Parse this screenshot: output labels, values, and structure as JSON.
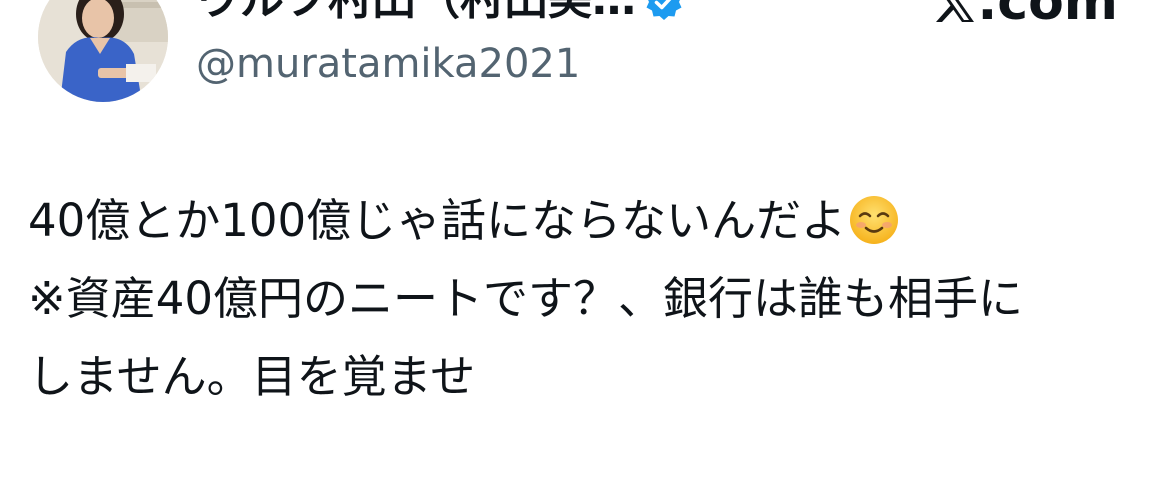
{
  "tweet": {
    "author": {
      "display_name": "ウルフ村田（村田美…",
      "handle": "@muratamika2021",
      "verified": true,
      "avatar_icon": "profile-photo-avatar"
    },
    "brand": {
      "label": ".com",
      "icon": "x-logo-icon"
    },
    "text_lines": [
      "40億とか100億じゃ話にならないんだよ",
      "※資産40億円のニートです？、銀行は誰も相手に",
      "しません。目を覚ませ"
    ],
    "emoji": "smiling-face-icon",
    "colors": {
      "text": "#0f1419",
      "secondary": "#536471",
      "verified_badge": "#1d9bf0",
      "background": "#ffffff"
    }
  }
}
